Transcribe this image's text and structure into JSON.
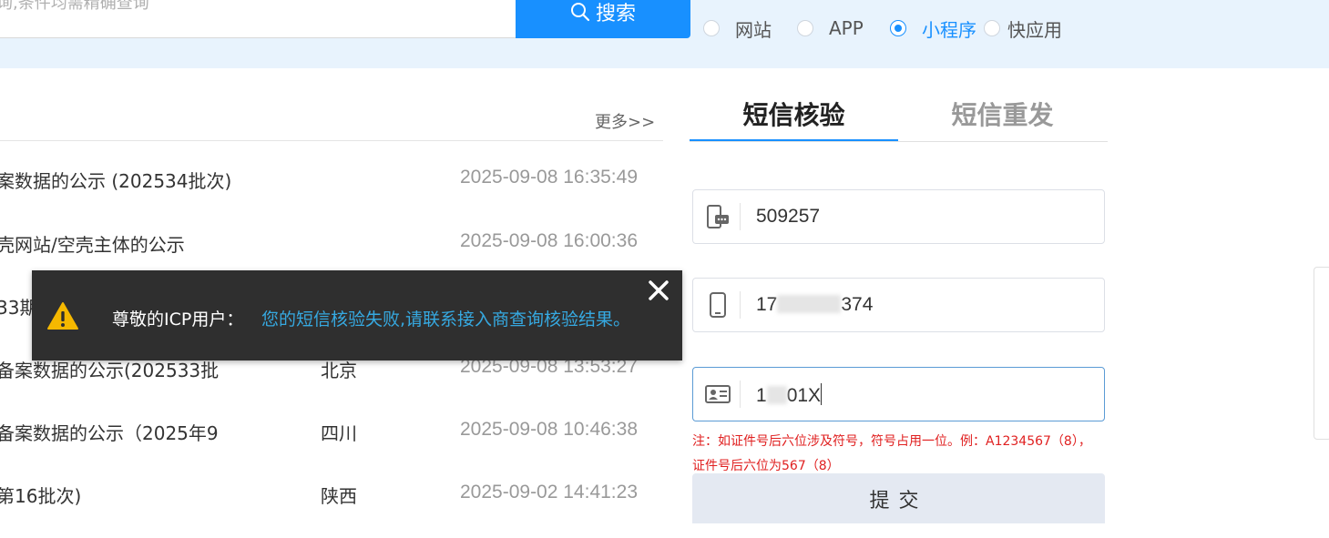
{
  "search": {
    "placeholder": "询,条件均需精确查询",
    "button_label": "搜索",
    "button_icon": "search-icon"
  },
  "type_filter": {
    "options": [
      {
        "label": "网站",
        "checked": false
      },
      {
        "label": "APP",
        "checked": false
      },
      {
        "label": "小程序",
        "checked": true
      },
      {
        "label": "快应用",
        "checked": false
      }
    ]
  },
  "notices": {
    "more_label": "更多>>",
    "rows": [
      {
        "title": "案数据的公示 (202534批次)",
        "region": "",
        "time": "2025-09-08 16:35:49"
      },
      {
        "title": "壳网站/空壳主体的公示",
        "region": "",
        "time": "2025-09-08 16:00:36"
      },
      {
        "title": "33期",
        "region": "",
        "time": ""
      },
      {
        "title": "备案数据的公示(202533批",
        "region": "北京",
        "time": "2025-09-08 13:53:27"
      },
      {
        "title": "备案数据的公示（2025年9",
        "region": "四川",
        "time": "2025-09-08 10:46:38"
      },
      {
        "title": "第16批次)",
        "region": "陕西",
        "time": "2025-09-02 14:41:23"
      }
    ]
  },
  "verify": {
    "tabs": [
      {
        "label": "短信核验",
        "active": true
      },
      {
        "label": "短信重发",
        "active": false
      }
    ],
    "sms_code": {
      "value": "509257",
      "icon": "sms-phone-icon"
    },
    "phone": {
      "prefix": "17",
      "suffix": "374",
      "icon": "mobile-phone-icon"
    },
    "id_number": {
      "prefix": "1",
      "suffix": "01X",
      "icon": "id-card-icon"
    },
    "note": "注：如证件号后六位涉及符号，符号占用一位。例：A1234567（8），证件号后六位为567（8）",
    "submit_label": "提交"
  },
  "toast": {
    "prefix": "尊敬的ICP用户：",
    "message": "您的短信核验失败,请联系接入商查询核验结果。",
    "icon": "warning-icon",
    "close_icon": "close-icon",
    "colors": {
      "background": "#2f2f2f",
      "message": "#36a9e1",
      "warning": "#f5b800"
    }
  },
  "colors": {
    "accent": "#1890ff",
    "band": "#e8f3fd",
    "error": "#e02020"
  }
}
